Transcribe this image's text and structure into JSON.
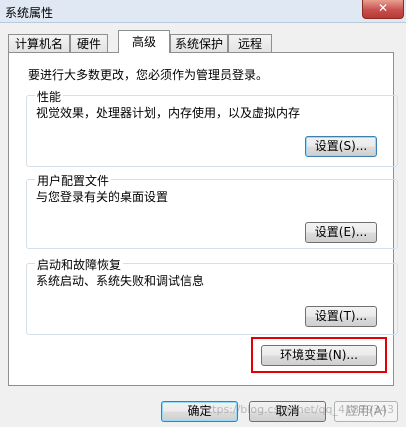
{
  "window": {
    "title": "系统属性",
    "close_glyph": "✕"
  },
  "tabs": [
    {
      "label": "计算机名",
      "active": false
    },
    {
      "label": "硬件",
      "active": false
    },
    {
      "label": "高级",
      "active": true
    },
    {
      "label": "系统保护",
      "active": false
    },
    {
      "label": "远程",
      "active": false
    }
  ],
  "main": {
    "intro": "要进行大多数更改，您必须作为管理员登录。",
    "performance": {
      "title": "性能",
      "desc": "视觉效果，处理器计划，内存使用，以及虚拟内存",
      "button": "设置(S)..."
    },
    "profiles": {
      "title": "用户配置文件",
      "desc": "与您登录有关的桌面设置",
      "button": "设置(E)..."
    },
    "startup": {
      "title": "启动和故障恢复",
      "desc": "系统启动、系统失败和调试信息",
      "button": "设置(T)..."
    },
    "env_button": "环境变量(N)..."
  },
  "footer": {
    "ok": "确定",
    "cancel": "取消",
    "apply": "应用(A)"
  },
  "watermark": "https://blog.csdn.net/qq_41879343",
  "colors": {
    "highlight": "#e30000",
    "focus_border": "#3c7fb1"
  }
}
